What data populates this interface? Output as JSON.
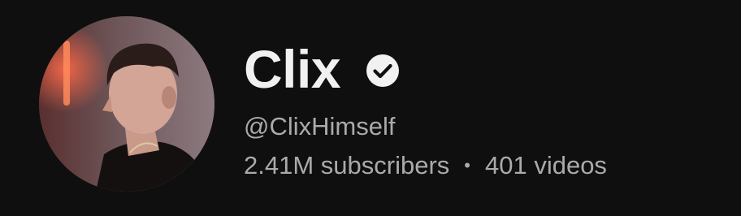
{
  "channel": {
    "name": "Clix",
    "handle": "@ClixHimself",
    "subscribers": "2.41M subscribers",
    "separator": "•",
    "videos": "401 videos",
    "verified": true
  },
  "icons": {
    "verified": "check-circle-icon",
    "avatar": "profile-photo"
  },
  "colors": {
    "background": "#0f0f0f",
    "primary_text": "#f1f1f1",
    "secondary_text": "#aaaaaa"
  }
}
